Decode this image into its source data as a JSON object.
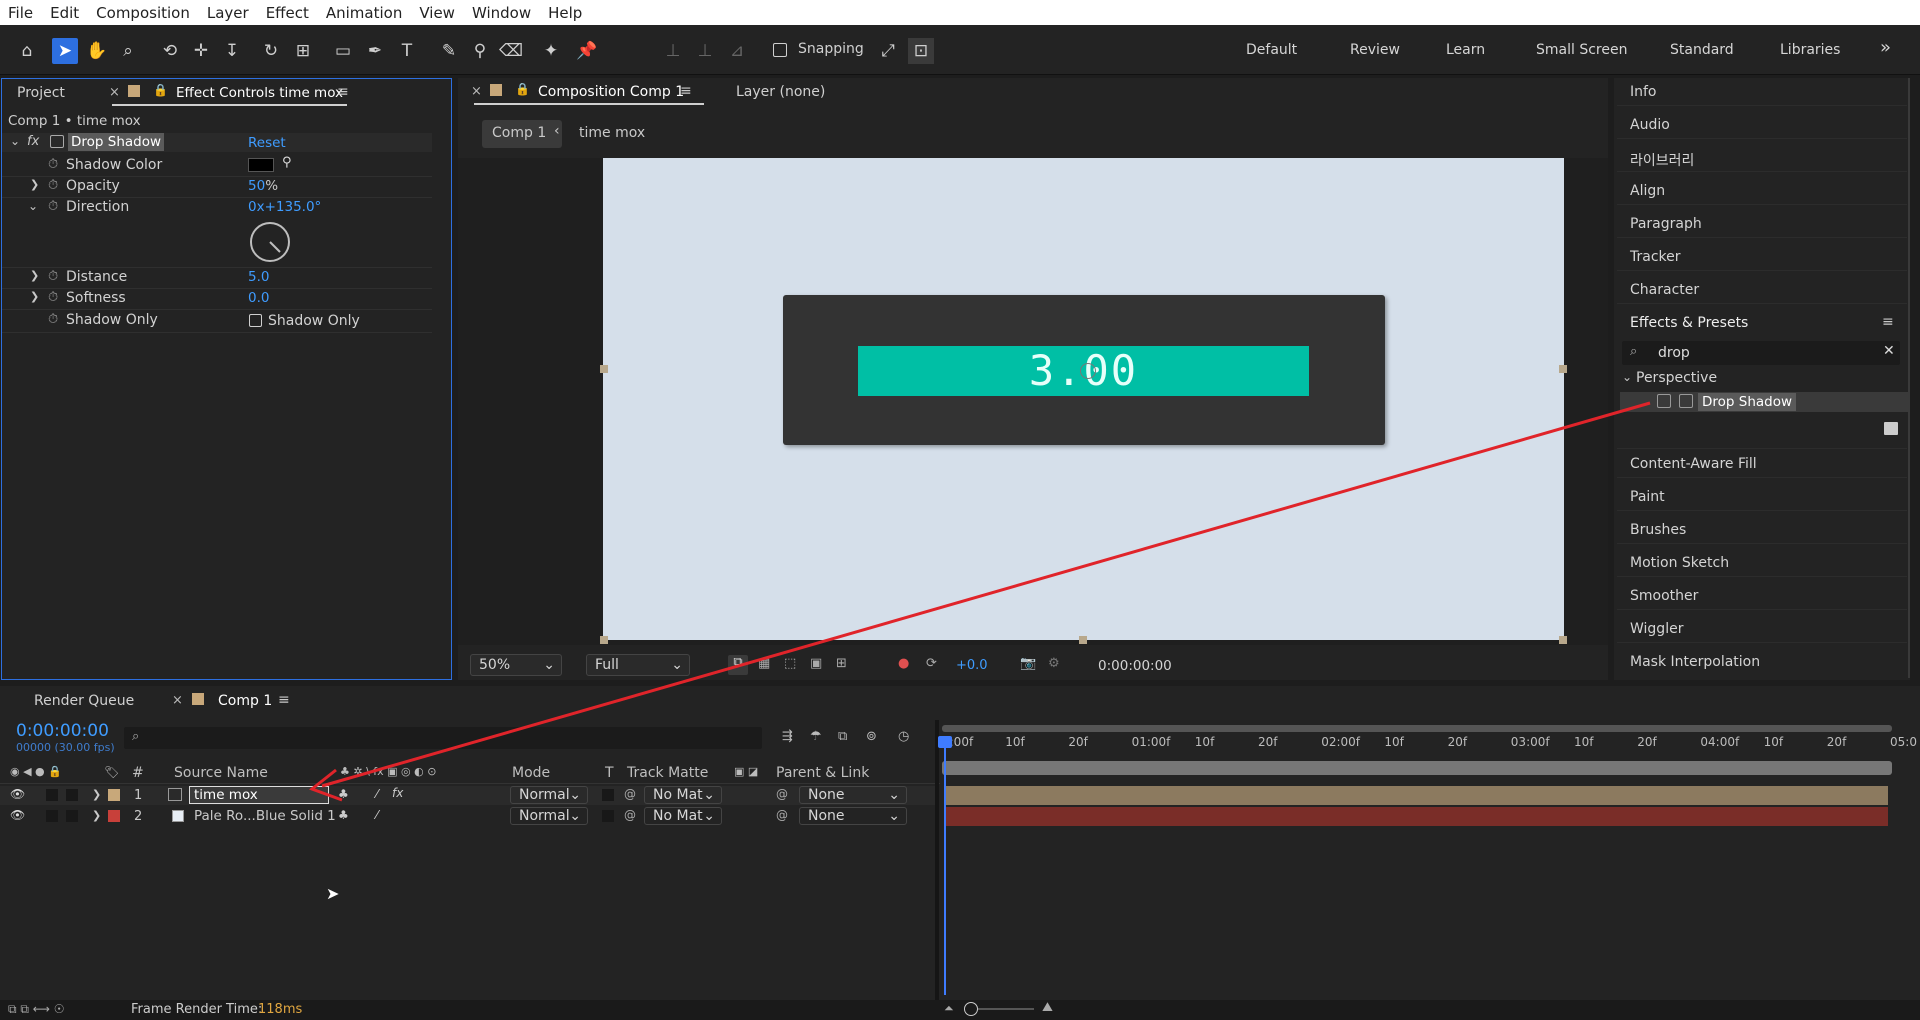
{
  "menu": [
    "File",
    "Edit",
    "Composition",
    "Layer",
    "Effect",
    "Animation",
    "View",
    "Window",
    "Help"
  ],
  "toolbar": {
    "snapping_label": "Snapping",
    "workspaces": [
      "Default",
      "Review",
      "Learn",
      "Small Screen",
      "Standard",
      "Libraries"
    ],
    "more": "»"
  },
  "left_panel": {
    "tab_project": "Project",
    "tab_effect_controls": "Effect Controls time mox",
    "breadcrumb": "Comp 1 • time mox",
    "effect_name": "Drop Shadow",
    "reset": "Reset",
    "fx": "fx",
    "props": {
      "shadow_color": "Shadow Color",
      "opacity_label": "Opacity",
      "opacity_value": "50",
      "opacity_unit": "%",
      "direction_label": "Direction",
      "direction_value": "0x+135.0°",
      "distance_label": "Distance",
      "distance_value": "5.0",
      "softness_label": "Softness",
      "softness_value": "0.0",
      "shadow_only_label": "Shadow Only",
      "shadow_only_checkbox": "Shadow Only"
    }
  },
  "comp_panel": {
    "tab_composition": "Composition Comp 1",
    "tab_layer": "Layer (none)",
    "breadcrumb_comp": "Comp 1",
    "breadcrumb_layer": "time mox",
    "counter_text": "3.00",
    "zoom": "50%",
    "resolution": "Full",
    "exposure": "+0.0",
    "timecode": "0:00:00:00"
  },
  "right_panel": {
    "items_top": [
      "Info",
      "Audio",
      "라이브러리",
      "Align",
      "Paragraph",
      "Tracker",
      "Character"
    ],
    "effects_title": "Effects & Presets",
    "search_value": "drop",
    "category": "Perspective",
    "result": "Drop Shadow",
    "items_bottom": [
      "Content-Aware Fill",
      "Paint",
      "Brushes",
      "Motion Sketch",
      "Smoother",
      "Wiggler",
      "Mask Interpolation"
    ]
  },
  "timeline": {
    "tab_render_queue": "Render Queue",
    "tab_comp": "Comp 1",
    "timecode": "0:00:00:00",
    "fps": "00000 (30.00 fps)",
    "columns": {
      "num": "#",
      "source_name": "Source Name",
      "mode": "Mode",
      "t": "T",
      "track_matte": "Track Matte",
      "parent": "Parent & Link"
    },
    "layers": [
      {
        "num": "1",
        "name": "time mox",
        "mode": "Normal",
        "matte": "No Mat",
        "parent": "None",
        "color": "#c8a87a"
      },
      {
        "num": "2",
        "name": "Pale Ro...Blue Solid 1",
        "mode": "Normal",
        "matte": "No Mat",
        "parent": "None",
        "color": "#c8403a"
      }
    ],
    "ruler": [
      "0:00f",
      "10f",
      "20f",
      "01:00f",
      "10f",
      "20f",
      "02:00f",
      "10f",
      "20f",
      "03:00f",
      "10f",
      "20f",
      "04:00f",
      "10f",
      "20f",
      "05:0"
    ],
    "render_time_label": "Frame Render Time:",
    "render_time_value": "118ms"
  },
  "colors": {
    "accent": "#2d6fe0",
    "blue_value": "#3f9cff",
    "teal_bar": "#00bfa5",
    "comp_bg": "#d5dfea",
    "arrow": "#e0242a"
  }
}
